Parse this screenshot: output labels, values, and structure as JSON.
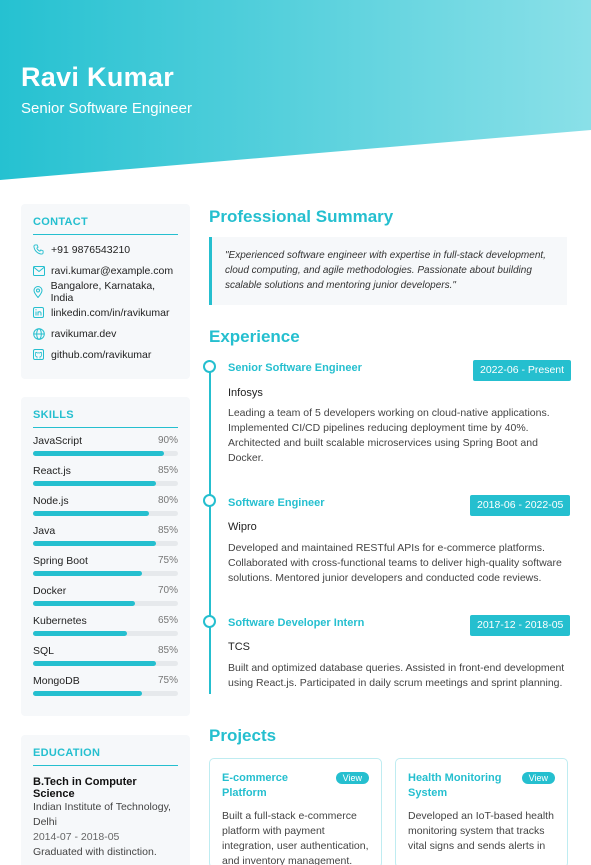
{
  "header": {
    "name": "Ravi Kumar",
    "title": "Senior Software Engineer",
    "gradient_start": "#25c1d1",
    "gradient_end": "#8ae0e8"
  },
  "contact": {
    "heading": "CONTACT",
    "items": [
      {
        "icon": "phone-icon",
        "text": "+91 9876543210"
      },
      {
        "icon": "email-icon",
        "text": "ravi.kumar@example.com"
      },
      {
        "icon": "location-icon",
        "text": "Bangalore, Karnataka, India"
      },
      {
        "icon": "linkedin-icon",
        "text": "linkedin.com/in/ravikumar"
      },
      {
        "icon": "globe-icon",
        "text": "ravikumar.dev"
      },
      {
        "icon": "github-icon",
        "text": "github.com/ravikumar"
      }
    ]
  },
  "skills": {
    "heading": "SKILLS",
    "items": [
      {
        "name": "JavaScript",
        "pct": "90%",
        "level": 0.9
      },
      {
        "name": "React.js",
        "pct": "85%",
        "level": 0.85
      },
      {
        "name": "Node.js",
        "pct": "80%",
        "level": 0.8
      },
      {
        "name": "Java",
        "pct": "85%",
        "level": 0.85
      },
      {
        "name": "Spring Boot",
        "pct": "75%",
        "level": 0.75
      },
      {
        "name": "Docker",
        "pct": "70%",
        "level": 0.7
      },
      {
        "name": "Kubernetes",
        "pct": "65%",
        "level": 0.65
      },
      {
        "name": "SQL",
        "pct": "85%",
        "level": 0.85
      },
      {
        "name": "MongoDB",
        "pct": "75%",
        "level": 0.75
      }
    ]
  },
  "education": {
    "heading": "EDUCATION",
    "degree": "B.Tech in Computer Science",
    "institution_line1": "Indian Institute of Technology,",
    "institution_line2": "Delhi",
    "dates": "2014-07 - 2018-05",
    "note": "Graduated with distinction."
  },
  "summary": {
    "heading": "Professional Summary",
    "text": "\"Experienced software engineer with expertise in full-stack development, cloud computing, and agile methodologies. Passionate about building scalable solutions and mentoring junior developers.\""
  },
  "experience": {
    "heading": "Experience",
    "jobs": [
      {
        "title": "Senior Software Engineer",
        "dates": "2022-06 - Present",
        "company": "Infosys",
        "description": "Leading a team of 5 developers working on cloud-native applications. Implemented CI/CD pipelines reducing deployment time by 40%. Architected and built scalable microservices using Spring Boot and Docker."
      },
      {
        "title": "Software Engineer",
        "dates": "2018-06 - 2022-05",
        "company": "Wipro",
        "description": "Developed and maintained RESTful APIs for e-commerce platforms. Collaborated with cross-functional teams to deliver high-quality software solutions. Mentored junior developers and conducted code reviews."
      },
      {
        "title": "Software Developer Intern",
        "dates": "2017-12 - 2018-05",
        "company": "TCS",
        "description": "Built and optimized database queries. Assisted in front-end development using React.js. Participated in daily scrum meetings and sprint planning."
      }
    ]
  },
  "projects": {
    "heading": "Projects",
    "items": [
      {
        "title": "E-commerce Platform",
        "view_label": "View",
        "description": "Built a full-stack e-commerce platform with payment integration, user authentication, and inventory management."
      },
      {
        "title": "Health Monitoring System",
        "view_label": "View",
        "description": "Developed an IoT-based health monitoring system that tracks vital signs and sends alerts in"
      }
    ]
  }
}
